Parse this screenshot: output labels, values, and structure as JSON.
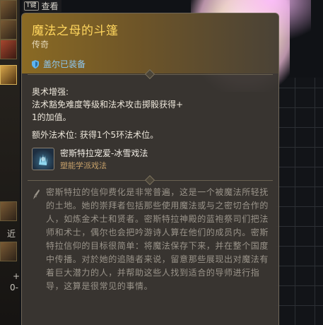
{
  "topbar": {
    "key": "T键",
    "label": "查看"
  },
  "left_panel": {
    "text_near": "近",
    "text_plus": "+",
    "text_zero": "0-"
  },
  "tooltip": {
    "title": "魔法之母的斗篷",
    "rarity": "传奇",
    "equipped_by": "盖尔已装备",
    "arcane_heading": "奥术增强:",
    "arcane_line1": "法术豁免难度等级和法术攻击掷骰获得+",
    "arcane_line2": "1的加值。",
    "extra_slot": "额外法术位: 获得1个5环法术位。",
    "spell": {
      "name": "密斯特拉宠爱-冰雪戏法",
      "school": "塑能学派戏法",
      "icon": "frost-hand-icon"
    },
    "lore": "密斯特拉的信仰费化是非常普遍，这是一个被魔法所轻抚的土地。她的崇拜者包括那些使用魔法或与之密切合作的人，如炼金术士和贤者。密斯特拉神殿的蓝袍祭司们把法师和术士，偶尔也会把吟游诗人算在他们的成员内。密斯特拉信仰的目标很简单：将魔法保存下来，并在整个国度中传播。对於她的追随者来说，留意那些展现出对魔法有着巨大潜力的人，并帮助这些人找到适合的导师进行指导，这算是很常见的事情。"
  },
  "colors": {
    "title": "#ffd65e",
    "equipped": "#8ec8f2",
    "school": "#c6a06a",
    "lore": "#9a948a"
  }
}
